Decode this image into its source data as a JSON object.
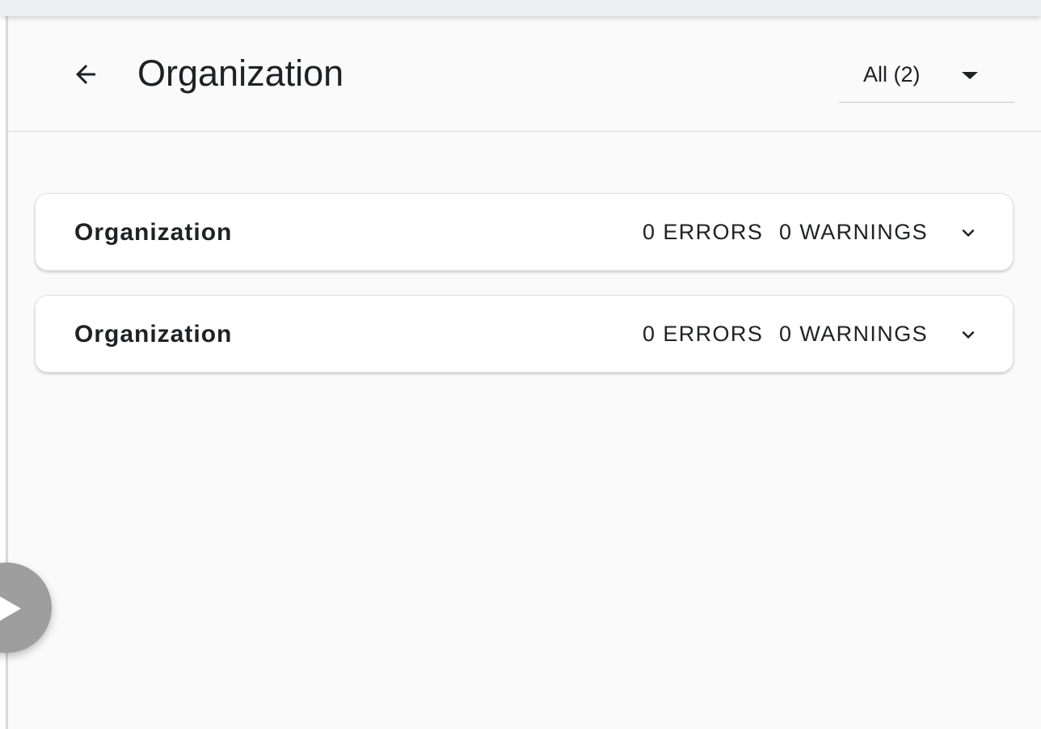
{
  "header": {
    "title": "Organization",
    "back_icon": "arrow-left-icon",
    "filter": {
      "selected": "All (2)",
      "caret_icon": "caret-down-icon"
    }
  },
  "panels": [
    {
      "title": "Organization",
      "errors": "0 ERRORS",
      "warnings": "0 WARNINGS",
      "chevron_icon": "chevron-down-icon"
    },
    {
      "title": "Organization",
      "errors": "0 ERRORS",
      "warnings": "0 WARNINGS",
      "chevron_icon": "chevron-down-icon"
    }
  ],
  "fab": {
    "icon": "play-icon",
    "color": "#9e9e9e"
  },
  "colors": {
    "background": "#fafafa",
    "surface": "#ffffff",
    "text": "#202124",
    "divider": "#dcdcdc"
  }
}
